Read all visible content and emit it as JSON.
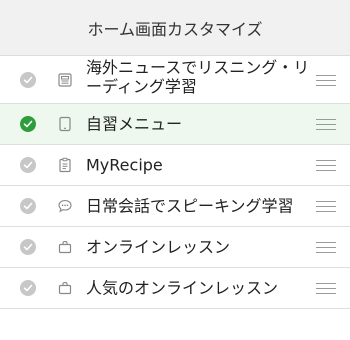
{
  "header": {
    "title": "ホーム画面カスタマイズ"
  },
  "items": [
    {
      "label": "海外ニュースでリスニング・リーディング学習",
      "checked": true,
      "icon": "news-icon"
    },
    {
      "label": "自習メニュー",
      "checked": true,
      "icon": "tablet-icon"
    },
    {
      "label": "MyRecipe",
      "checked": true,
      "icon": "clipboard-icon"
    },
    {
      "label": "日常会話でスピーキング学習",
      "checked": true,
      "icon": "speech-bubble-icon"
    },
    {
      "label": "オンラインレッスン",
      "checked": true,
      "icon": "bag-icon"
    },
    {
      "label": "人気のオンラインレッスン",
      "checked": true,
      "icon": "bag-icon"
    }
  ],
  "colors": {
    "check_on": "#2e9d3d",
    "check_off": "#c7c7c7",
    "selected_row_bg": "#eef8ee"
  }
}
